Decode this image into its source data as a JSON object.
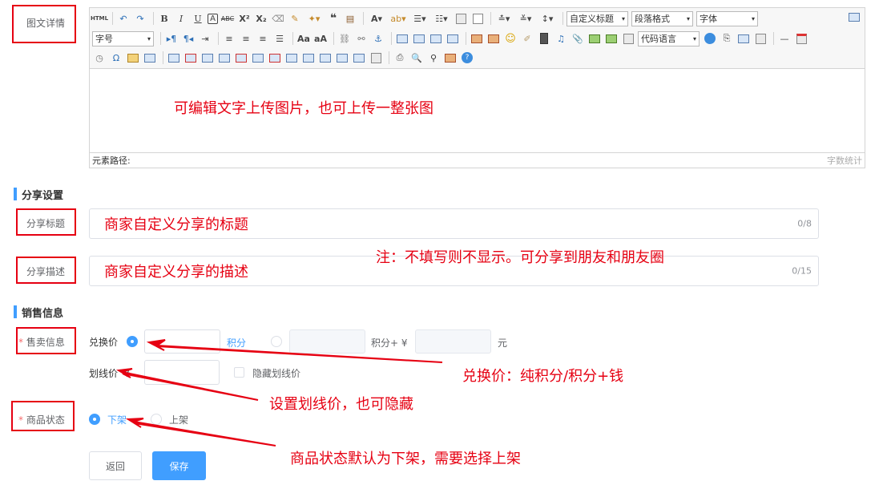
{
  "labels": {
    "content_detail": "图文详情",
    "share_title": "分享标题",
    "share_desc": "分享描述",
    "sale_info": "售卖信息",
    "product_status": "商品状态"
  },
  "required_mark": "*",
  "editor": {
    "toolbar": {
      "html": "HTML",
      "bold": "B",
      "italic": "I",
      "underline": "U",
      "custom_title": "自定义标题",
      "paragraph": "段落格式",
      "font": "字体",
      "font_size": "字号",
      "code_lang": "代码语言"
    },
    "annotation": "可编辑文字上传图片，也可上传一整张图",
    "path_label": "元素路径:",
    "word_count": "字数统计"
  },
  "sections": {
    "share": "分享设置",
    "sales": "销售信息"
  },
  "share": {
    "title_value": "商家自定义分享的标题",
    "title_count": "0/8",
    "desc_value": "商家自定义分享的描述",
    "desc_count": "0/15",
    "note": "注：不填写则不显示。可分享到朋友和朋友圈"
  },
  "sale": {
    "exchange_label": "兑换价",
    "points_unit": "积分",
    "points_plus": "积分+",
    "currency": "¥",
    "yuan": "元",
    "strike_label": "划线价",
    "strike_currency": "¥",
    "hide_strike": "隐藏划线价"
  },
  "status": {
    "options": [
      "下架",
      "上架"
    ],
    "selected": "下架"
  },
  "buttons": {
    "back": "返回",
    "save": "保存"
  },
  "annotations": {
    "exchange": "兑换价：纯积分/积分+钱",
    "strike": "设置划线价，也可隐藏",
    "status": "商品状态默认为下架，需要选择上架"
  }
}
